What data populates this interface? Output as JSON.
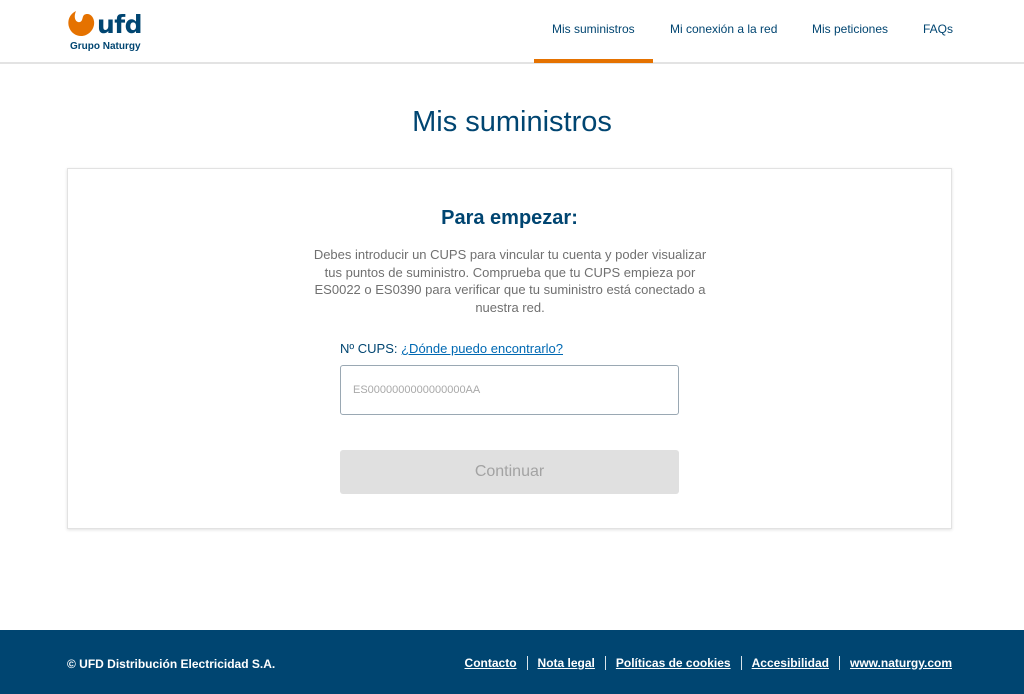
{
  "header": {
    "logo": {
      "word": "ufd",
      "subtitle": "Grupo Naturgy",
      "icon": "naturgy-logo-icon",
      "brand_color": "#e57200"
    },
    "nav": [
      {
        "label": "Mis suministros",
        "active": true
      },
      {
        "label": "Mi conexión a la red",
        "active": false
      },
      {
        "label": "Mis peticiones",
        "active": false
      },
      {
        "label": "FAQs",
        "active": false
      }
    ]
  },
  "page": {
    "title": "Mis suministros"
  },
  "card": {
    "heading": "Para empezar:",
    "description": "Debes introducir un CUPS para vincular tu cuenta y poder visualizar tus puntos de suministro. Comprueba que tu CUPS empieza por ES0022 o ES0390 para verificar que tu suministro está conectado a nuestra red.",
    "cups_label": "Nº CUPS:",
    "cups_help_link": "¿Dónde puedo encontrarlo?",
    "cups_input": {
      "value": "",
      "placeholder": "ES0000000000000000AA"
    },
    "continue_button": "Continuar",
    "continue_disabled": true
  },
  "footer": {
    "copyright": "© UFD Distribución Electricidad S.A.",
    "links": [
      "Contacto",
      "Nota legal",
      "Políticas de cookies",
      "Accesibilidad",
      "www.naturgy.com"
    ]
  },
  "colors": {
    "primary": "#004571",
    "accent": "#e57200",
    "link": "#0069b3",
    "footer_bg": "#004571"
  }
}
